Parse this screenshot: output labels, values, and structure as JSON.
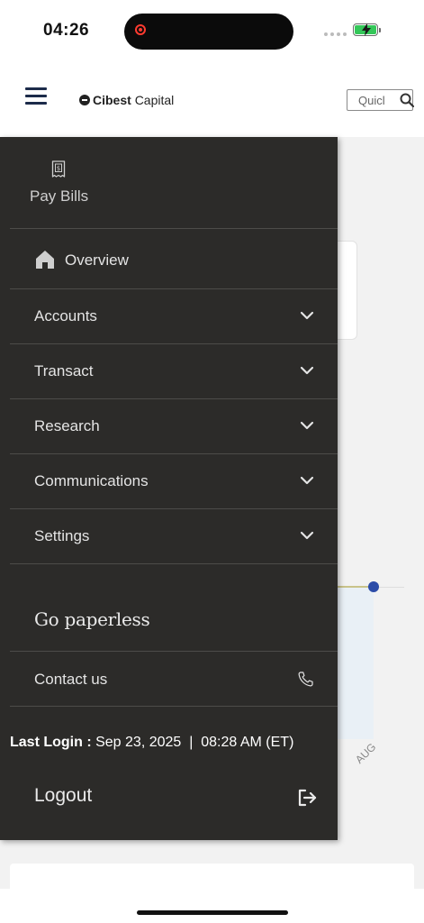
{
  "status_bar": {
    "time": "04:26"
  },
  "header": {
    "logo_bold": "Cibest",
    "logo_regular": "Capital",
    "search_value": "Quicl"
  },
  "background": {
    "axis_label": "AUG"
  },
  "menu": {
    "pay_bills_label": "Pay Bills",
    "overview_label": "Overview",
    "items": [
      {
        "label": "Accounts"
      },
      {
        "label": "Transact"
      },
      {
        "label": "Research"
      },
      {
        "label": "Communications"
      },
      {
        "label": "Settings"
      }
    ],
    "go_paperless": "Go paperless",
    "contact_us": "Contact us",
    "last_login_label": "Last Login :",
    "last_login_date": "Sep 23, 2025",
    "last_login_separator": "|",
    "last_login_time": "08:28 AM (ET)",
    "logout_label": "Logout"
  },
  "colors": {
    "drawer_bg": "#2c2b29",
    "brand_navy": "#1c2b4a",
    "battery_green": "#34c759",
    "record_red": "#ff3b30",
    "chart_point": "#2c4ca8"
  },
  "icons": {
    "hamburger": "menu-icon",
    "search": "search-icon",
    "pay_bills": "receipt-dollar-icon",
    "overview": "home-icon",
    "expand": "chevron-down-icon",
    "contact": "phone-icon",
    "logout": "logout-icon"
  }
}
